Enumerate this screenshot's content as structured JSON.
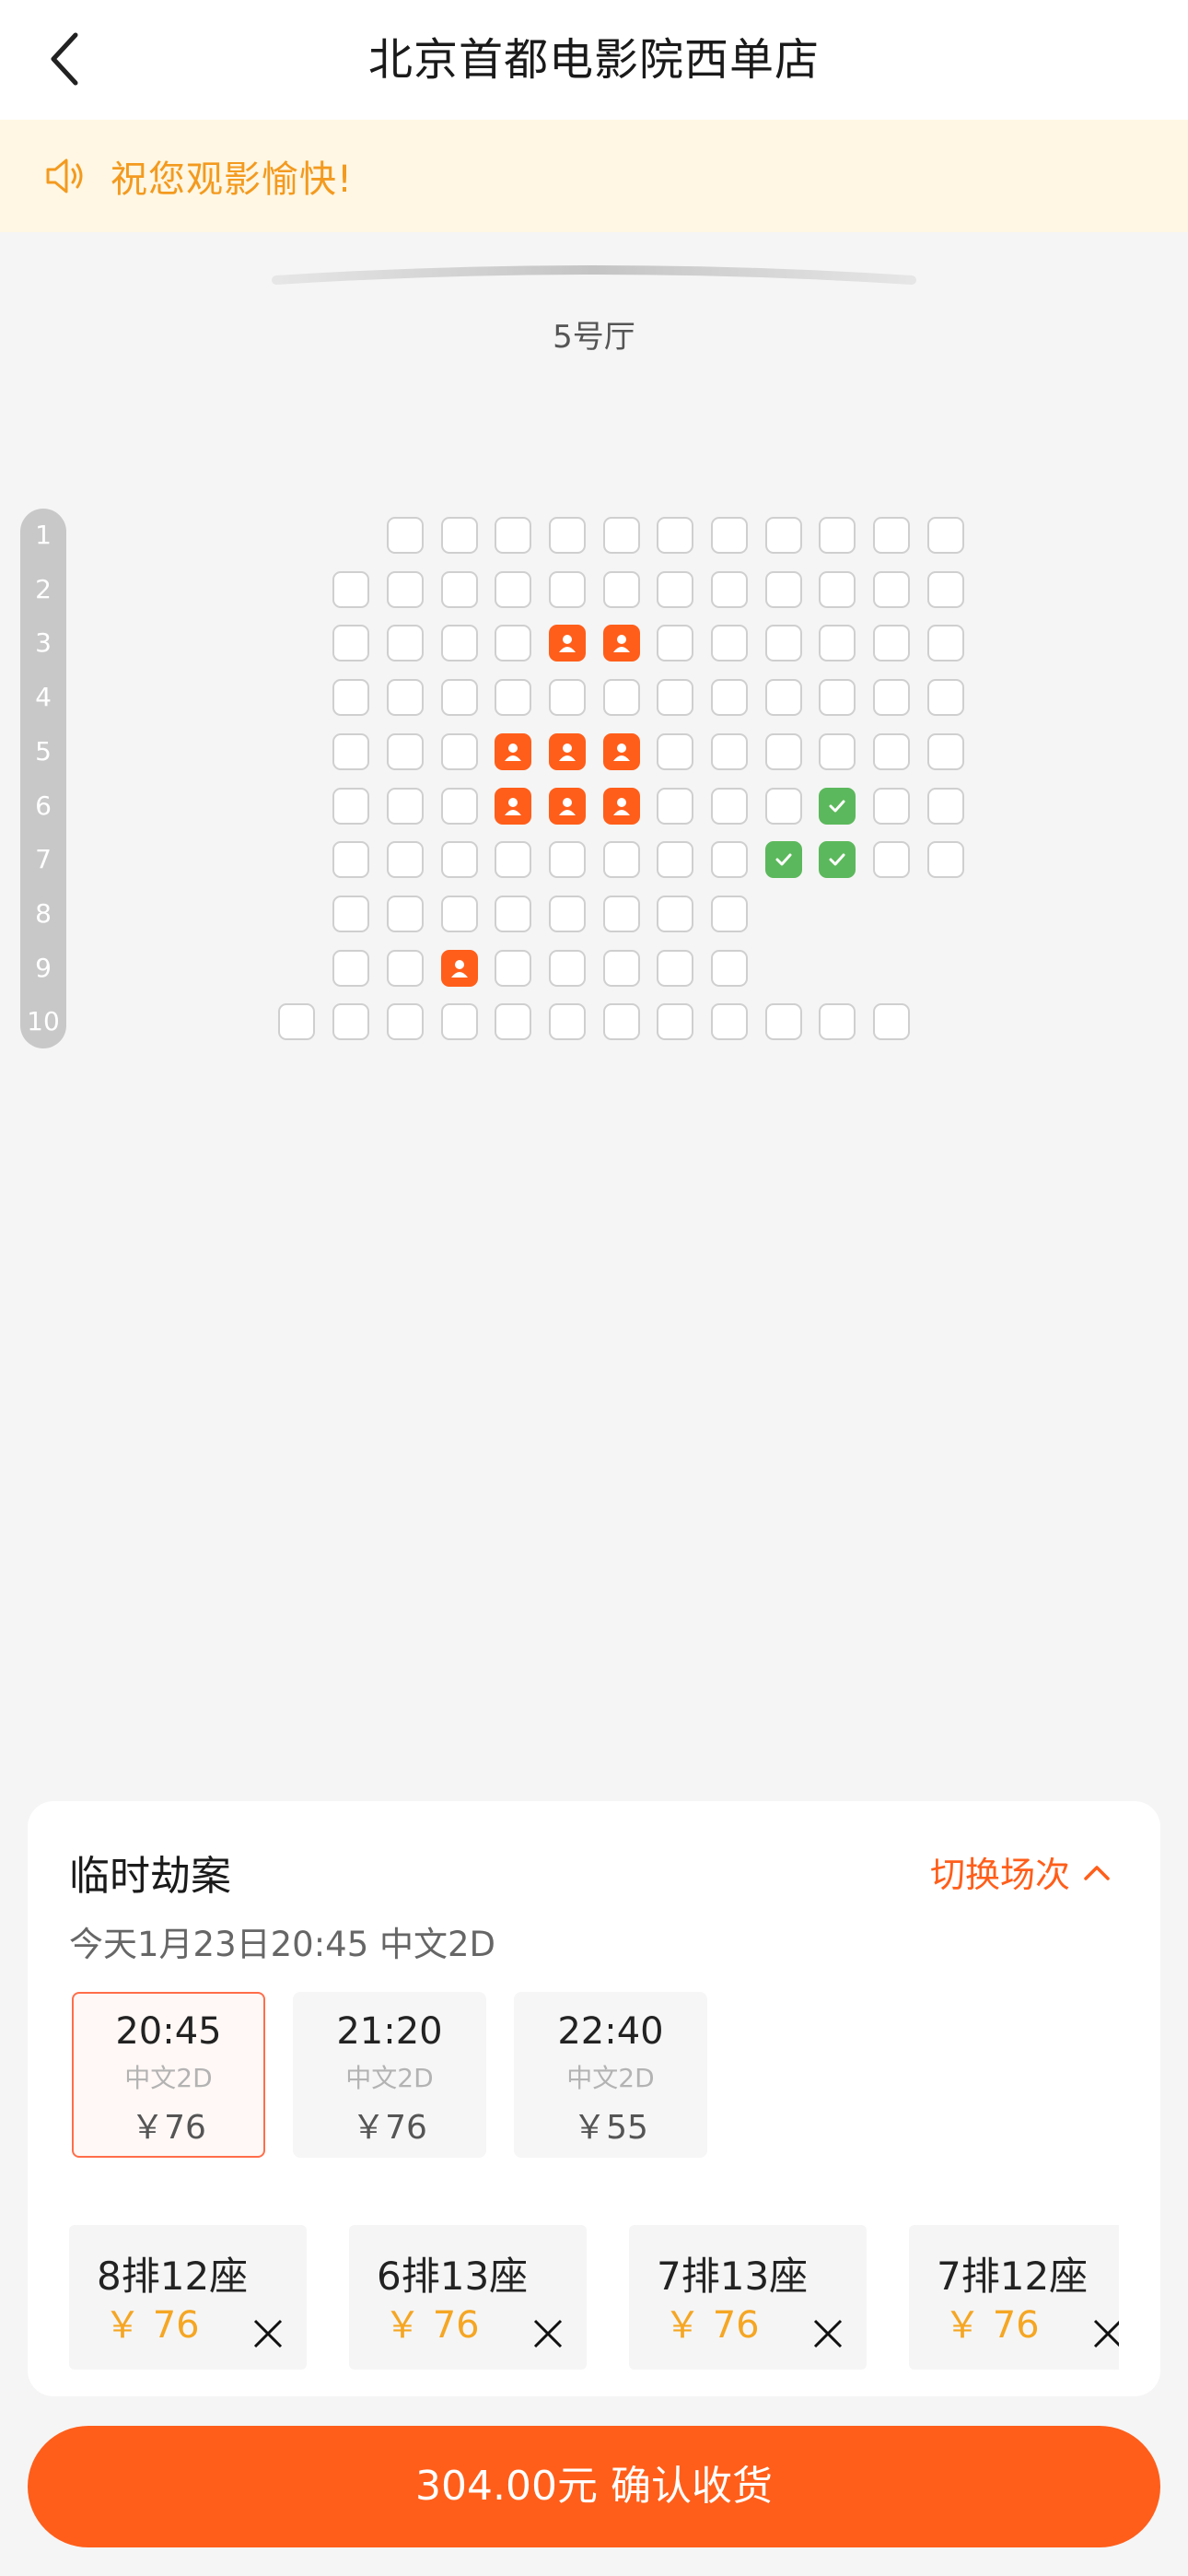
{
  "header": {
    "title": "北京首都电影院西单店",
    "back_icon": "chevron-left-icon"
  },
  "notice": {
    "text": "祝您观影愉快!",
    "icon": "speaker-icon"
  },
  "hall": {
    "name": "5号厅"
  },
  "seat_map": {
    "rows": [
      "1",
      "2",
      "3",
      "4",
      "5",
      "6",
      "7",
      "8",
      "9",
      "10"
    ],
    "status_colors": {
      "available": "#ffffff",
      "sold": "#ff5e1a",
      "selected": "#5cb85c"
    }
  },
  "movie": {
    "title": "临时劫案",
    "switch_label": "切换场次",
    "show_info": "今天1月23日20:45 中文2D"
  },
  "showtimes": [
    {
      "time": "20:45",
      "lang": "中文2D",
      "price": "￥76",
      "active": true
    },
    {
      "time": "21:20",
      "lang": "中文2D",
      "price": "￥76",
      "active": false
    },
    {
      "time": "22:40",
      "lang": "中文2D",
      "price": "￥55",
      "active": false
    }
  ],
  "selected_tickets": [
    {
      "seat": "8排12座",
      "price": "￥ 76"
    },
    {
      "seat": "6排13座",
      "price": "￥ 76"
    },
    {
      "seat": "7排13座",
      "price": "￥ 76"
    },
    {
      "seat": "7排12座",
      "price": "￥ 76"
    }
  ],
  "confirm": {
    "label": "304.00元 确认收货"
  },
  "colors": {
    "accent": "#ff5e1a",
    "price": "#f5a623",
    "notice_bg": "#fff7e3",
    "notice_text": "#f39a1f"
  }
}
